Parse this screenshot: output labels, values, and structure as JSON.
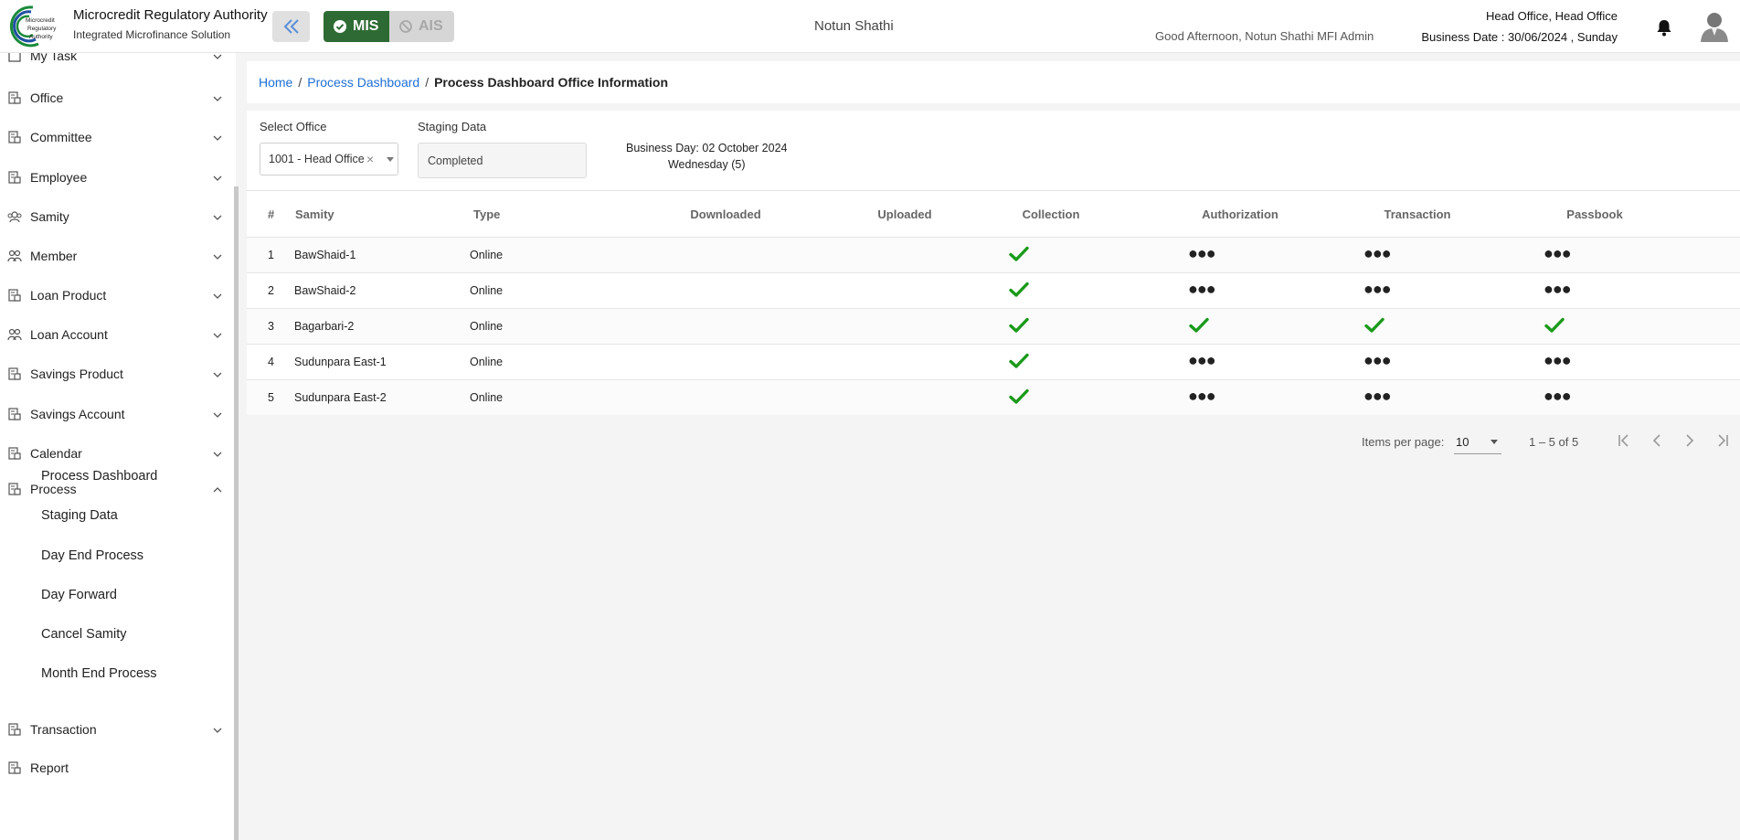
{
  "header": {
    "brand_title": "Microcredit Regulatory Authority",
    "brand_sub": "Integrated Microfinance Solution",
    "logo_text": [
      "Microcredit",
      "Regulatory",
      "Authority"
    ],
    "mis_label": "MIS",
    "ais_label": "AIS",
    "center_title": "Notun Shathi",
    "greeting": "Good Afternoon, Notun Shathi MFI Admin",
    "office": "Head Office, Head Office",
    "business_date": "Business Date : 30/06/2024 , Sunday",
    "brand_color": "#2e6b34"
  },
  "sidebar": {
    "partial_top": "My Task",
    "items": [
      {
        "label": "Office",
        "icon": "building-icon"
      },
      {
        "label": "Committee",
        "icon": "building-icon"
      },
      {
        "label": "Employee",
        "icon": "building-icon"
      },
      {
        "label": "Samity",
        "icon": "group-icon"
      },
      {
        "label": "Member",
        "icon": "people-icon"
      },
      {
        "label": "Loan Product",
        "icon": "building-icon"
      },
      {
        "label": "Loan Account",
        "icon": "people-icon"
      },
      {
        "label": "Savings Product",
        "icon": "building-icon"
      },
      {
        "label": "Savings Account",
        "icon": "building-icon"
      },
      {
        "label": "Calendar",
        "icon": "building-icon"
      },
      {
        "label": "Process",
        "icon": "building-icon"
      }
    ],
    "process_sub": [
      "Process Dashboard",
      "Staging Data",
      "Day End Process",
      "Day Forward",
      "Cancel Samity",
      "Month End Process"
    ],
    "bottom_items": [
      {
        "label": "Transaction",
        "icon": "building-icon"
      },
      {
        "label": "Report",
        "icon": "building-icon"
      }
    ]
  },
  "breadcrumb": {
    "home": "Home",
    "parent": "Process Dashboard",
    "current": "Process Dashboard Office Information",
    "sep": "/"
  },
  "filters": {
    "office_label": "Select Office",
    "office_value": "1001 - Head Office",
    "staging_label": "Staging Data",
    "staging_value": "Completed",
    "business_day": "Business Day: 02 October 2024",
    "weekday": "Wednesday (5)"
  },
  "table": {
    "columns": [
      "#",
      "Samity",
      "Type",
      "Downloaded",
      "Uploaded",
      "Collection",
      "Authorization",
      "Transaction",
      "Passbook"
    ],
    "rows": [
      {
        "no": "1",
        "samity": "BawShaid-1",
        "type": "Online",
        "collection": "check",
        "authorization": "pending",
        "transaction": "pending",
        "passbook": "pending"
      },
      {
        "no": "2",
        "samity": "BawShaid-2",
        "type": "Online",
        "collection": "check",
        "authorization": "pending",
        "transaction": "pending",
        "passbook": "pending"
      },
      {
        "no": "3",
        "samity": "Bagarbari-2",
        "type": "Online",
        "collection": "check",
        "authorization": "check",
        "transaction": "check",
        "passbook": "check"
      },
      {
        "no": "4",
        "samity": "Sudunpara East-1",
        "type": "Online",
        "collection": "check",
        "authorization": "pending",
        "transaction": "pending",
        "passbook": "pending"
      },
      {
        "no": "5",
        "samity": "Sudunpara East-2",
        "type": "Online",
        "collection": "check",
        "authorization": "pending",
        "transaction": "pending",
        "passbook": "pending"
      }
    ],
    "pending_glyph": "●●●",
    "check_color": "#1a9a1a"
  },
  "paginator": {
    "items_per_page_label": "Items per page:",
    "items_per_page": "10",
    "range": "1 – 5 of 5"
  }
}
